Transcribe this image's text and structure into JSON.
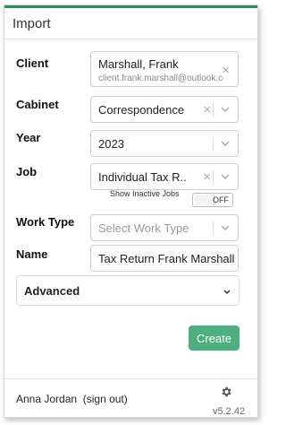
{
  "header": {
    "title": "Import"
  },
  "form": {
    "client": {
      "label": "Client",
      "name": "Marshall, Frank",
      "email": "client.frank.marshall@outlook.com"
    },
    "cabinet": {
      "label": "Cabinet",
      "value": "Correspondence"
    },
    "year": {
      "label": "Year",
      "value": "2023"
    },
    "job": {
      "label": "Job",
      "value": "Individual Tax R..."
    },
    "inactive": {
      "label": "Show Inactive Jobs",
      "state": "OFF"
    },
    "work_type": {
      "label": "Work Type",
      "placeholder": "Select Work Type"
    },
    "name": {
      "label": "Name",
      "value": "Tax Return Frank Marshall"
    },
    "advanced": {
      "label": "Advanced"
    },
    "create_label": "Create"
  },
  "footer": {
    "user": "Anna Jordan",
    "signout": "(sign out)",
    "version": "v5.2.42"
  },
  "colors": {
    "accent": "#2f8f5b",
    "button": "#4caf7d"
  }
}
